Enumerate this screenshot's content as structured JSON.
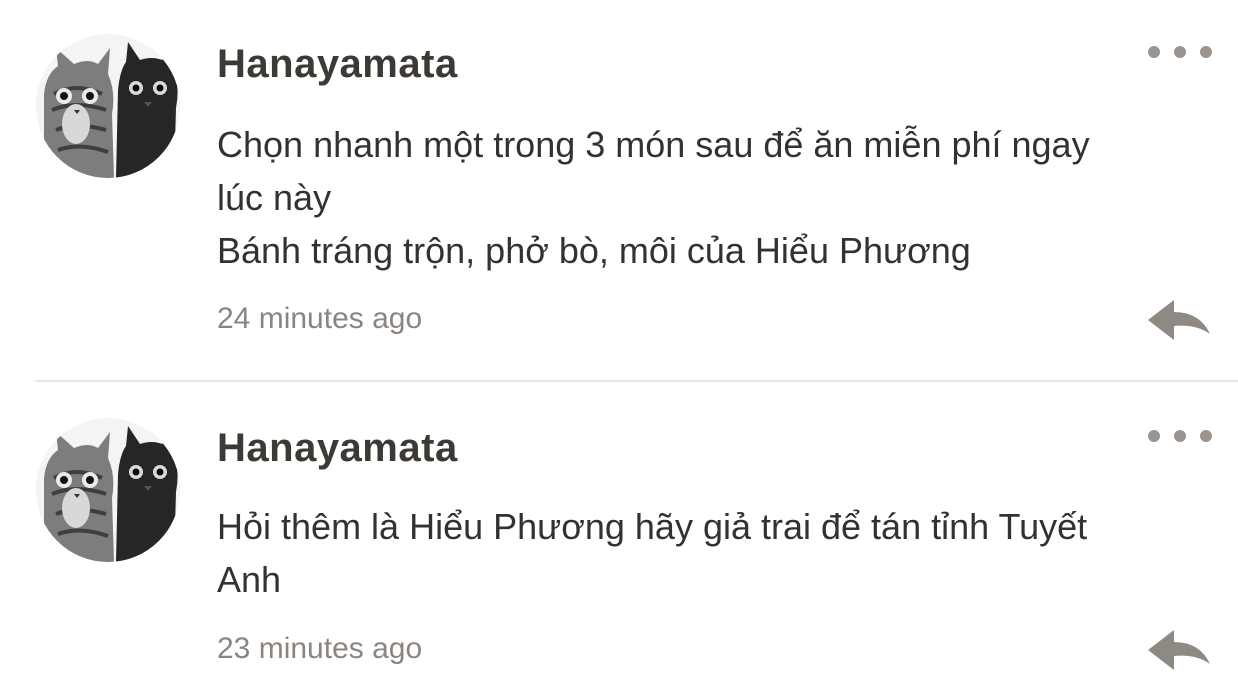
{
  "colors": {
    "author": "#3d3935",
    "body": "#35312e",
    "timestamp": "#8c857f",
    "icon": "#9b948f",
    "divider": "#e8e6e4"
  },
  "comments": [
    {
      "author": "Hanayamata",
      "avatar_icon": "cats-avatar-icon",
      "lines": [
        "Chọn nhanh một trong 3 món sau để ăn miễn phí ngay",
        "lúc này",
        "Bánh tráng trộn, phở bò, môi của Hiểu Phương"
      ],
      "time": "24 minutes ago",
      "more_icon": "more-options-icon",
      "reply_icon": "reply-icon"
    },
    {
      "author": "Hanayamata",
      "avatar_icon": "cats-avatar-icon",
      "lines": [
        "Hỏi thêm là Hiểu Phương hãy giả trai để tán tỉnh Tuyết",
        "Anh"
      ],
      "time": "23 minutes ago",
      "more_icon": "more-options-icon",
      "reply_icon": "reply-icon"
    }
  ]
}
